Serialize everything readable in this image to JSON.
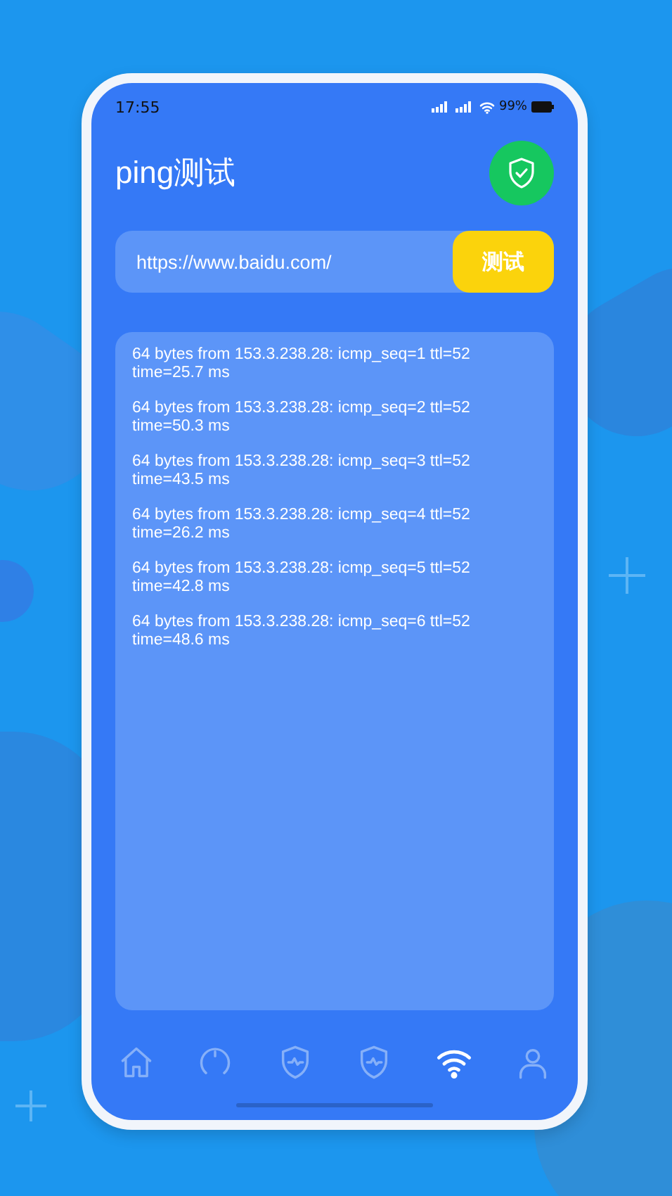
{
  "status_bar": {
    "time": "17:55",
    "battery": "99%"
  },
  "header": {
    "title": "ping测试"
  },
  "search": {
    "value": "https://www.baidu.com/",
    "button": "测试"
  },
  "results": [
    {
      "line1": "64 bytes from 153.3.238.28: icmp_seq=1 ttl=52",
      "line2": "time=25.7 ms"
    },
    {
      "line1": "64 bytes from 153.3.238.28: icmp_seq=2 ttl=52",
      "line2": "time=50.3 ms"
    },
    {
      "line1": "64 bytes from 153.3.238.28: icmp_seq=3 ttl=52",
      "line2": "time=43.5 ms"
    },
    {
      "line1": "64 bytes from 153.3.238.28: icmp_seq=4 ttl=52",
      "line2": "time=26.2 ms"
    },
    {
      "line1": "64 bytes from 153.3.238.28: icmp_seq=5 ttl=52",
      "line2": "time=42.8 ms"
    },
    {
      "line1": "64 bytes from 153.3.238.28: icmp_seq=6 ttl=52",
      "line2": "time=48.6 ms"
    }
  ],
  "nav": [
    {
      "kind": "home",
      "selected": false
    },
    {
      "kind": "gauge",
      "selected": false
    },
    {
      "kind": "shield",
      "selected": false
    },
    {
      "kind": "shield",
      "selected": false
    },
    {
      "kind": "wifi",
      "selected": true
    },
    {
      "kind": "user",
      "selected": false
    }
  ]
}
